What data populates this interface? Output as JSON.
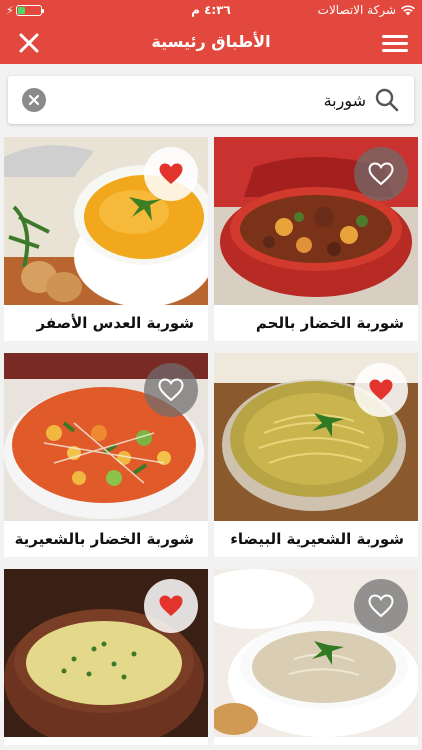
{
  "status_bar": {
    "carrier": "شركة الاتصالات",
    "time": "٤:٣٦ م",
    "battery_level": 0.35
  },
  "nav": {
    "title": "الأطباق رئيسية",
    "close_icon": "close-icon",
    "menu_icon": "hamburger-menu-icon"
  },
  "search": {
    "value": "شوربة",
    "placeholder": "",
    "search_icon": "search-icon",
    "clear_icon": "clear-icon"
  },
  "colors": {
    "accent": "#e2483d",
    "heart_active": "#e2342d"
  },
  "recipes": [
    {
      "title": "شوربة الخضار بالحم",
      "favorite": false
    },
    {
      "title": "شوربة العدس الأصفر",
      "favorite": true
    },
    {
      "title": "شوربة الشعيرية البيضاء",
      "favorite": true
    },
    {
      "title": "شوربة الخضار بالشعيرية",
      "favorite": false
    },
    {
      "title": "",
      "favorite": false
    },
    {
      "title": "",
      "favorite": true
    }
  ]
}
